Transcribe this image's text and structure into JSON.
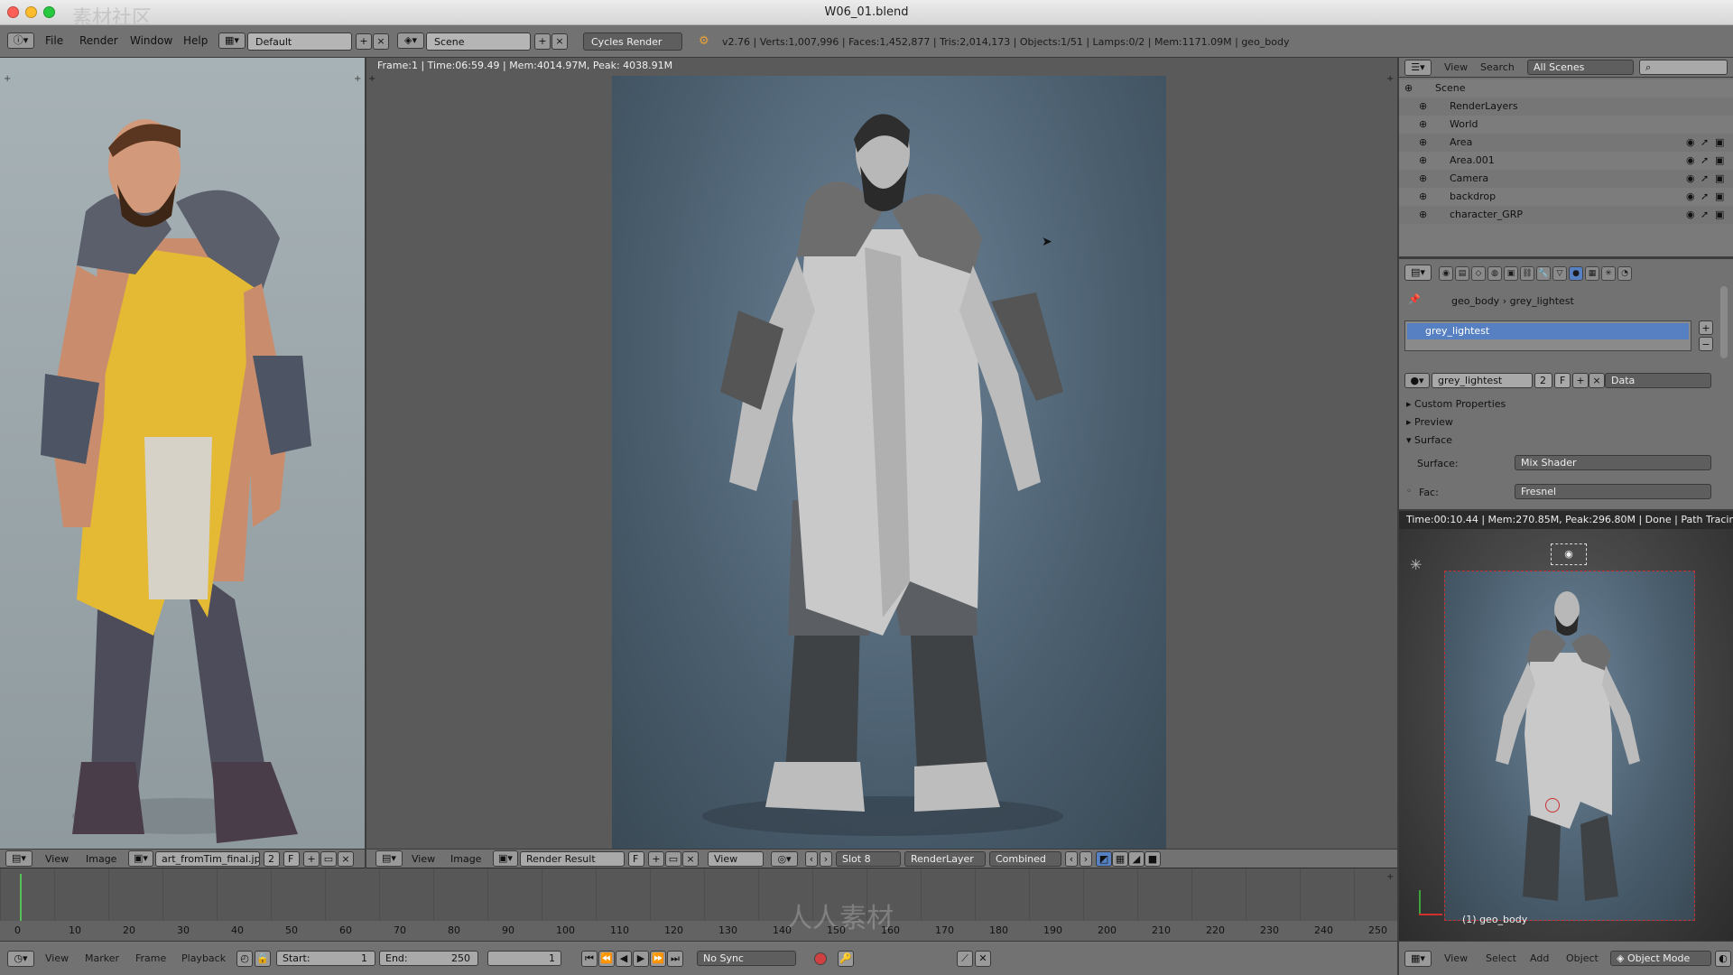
{
  "window": {
    "title": "W06_01.blend",
    "watermark": "素材社区"
  },
  "menu": {
    "items": [
      "File",
      "Render",
      "Window",
      "Help"
    ]
  },
  "info": {
    "screen_layout": "Default",
    "scene": "Scene",
    "engine": "Cycles Render",
    "stats": "v2.76 | Verts:1,007,996 | Faces:1,452,877 | Tris:2,014,173 | Objects:1/51 | Lamps:0/2 | Mem:1171.09M | geo_body"
  },
  "render_view": {
    "status": "Frame:1 | Time:06:59.49 | Mem:4014.97M, Peak: 4038.91M",
    "header": {
      "view": "View",
      "image": "Image",
      "image_name": "Render Result",
      "f": "F",
      "view2": "View",
      "slot": "Slot 8",
      "layer": "RenderLayer",
      "pass": "Combined"
    }
  },
  "ref_view": {
    "header": {
      "view": "View",
      "image": "Image",
      "image_name": "art_fromTim_final.jpg",
      "users": "2",
      "f": "F"
    }
  },
  "timeline": {
    "ticks": [
      "0",
      "10",
      "20",
      "30",
      "40",
      "50",
      "60",
      "70",
      "80",
      "90",
      "100",
      "110",
      "120",
      "130",
      "140",
      "150",
      "160",
      "170",
      "180",
      "190",
      "200",
      "210",
      "220",
      "230",
      "240",
      "250"
    ],
    "header": {
      "view": "View",
      "marker": "Marker",
      "frame": "Frame",
      "playback": "Playback",
      "start": "Start:",
      "start_val": "1",
      "end": "End:",
      "end_val": "250",
      "current": "1",
      "sync": "No Sync"
    },
    "watermark": "人人素材"
  },
  "outliner": {
    "header": {
      "view": "View",
      "search": "Search",
      "scenes": "All Scenes"
    },
    "items": [
      {
        "label": "Scene",
        "indent": 0
      },
      {
        "label": "RenderLayers",
        "indent": 1
      },
      {
        "label": "World",
        "indent": 1
      },
      {
        "label": "Area",
        "indent": 1
      },
      {
        "label": "Area.001",
        "indent": 1
      },
      {
        "label": "Camera",
        "indent": 1
      },
      {
        "label": "backdrop",
        "indent": 1
      },
      {
        "label": "character_GRP",
        "indent": 1
      }
    ]
  },
  "properties": {
    "breadcrumb": [
      "geo_body",
      "grey_lightest"
    ],
    "slot_item": "grey_lightest",
    "material_name": "grey_lightest",
    "material_users": "2",
    "f": "F",
    "data_mode": "Data",
    "sections": [
      "Custom Properties",
      "Preview",
      "Surface"
    ],
    "surface_label": "Surface:",
    "surface_value": "Mix Shader",
    "fac_label": "Fac:",
    "fac_value": "Fresnel"
  },
  "camera_view": {
    "status": "Time:00:10.44 | Mem:270.85M, Peak:296.80M | Done | Path Tracing Sa",
    "object_label": "(1) geo_body",
    "footer": {
      "view": "View",
      "select": "Select",
      "add": "Add",
      "object": "Object",
      "mode": "Object Mode"
    }
  }
}
